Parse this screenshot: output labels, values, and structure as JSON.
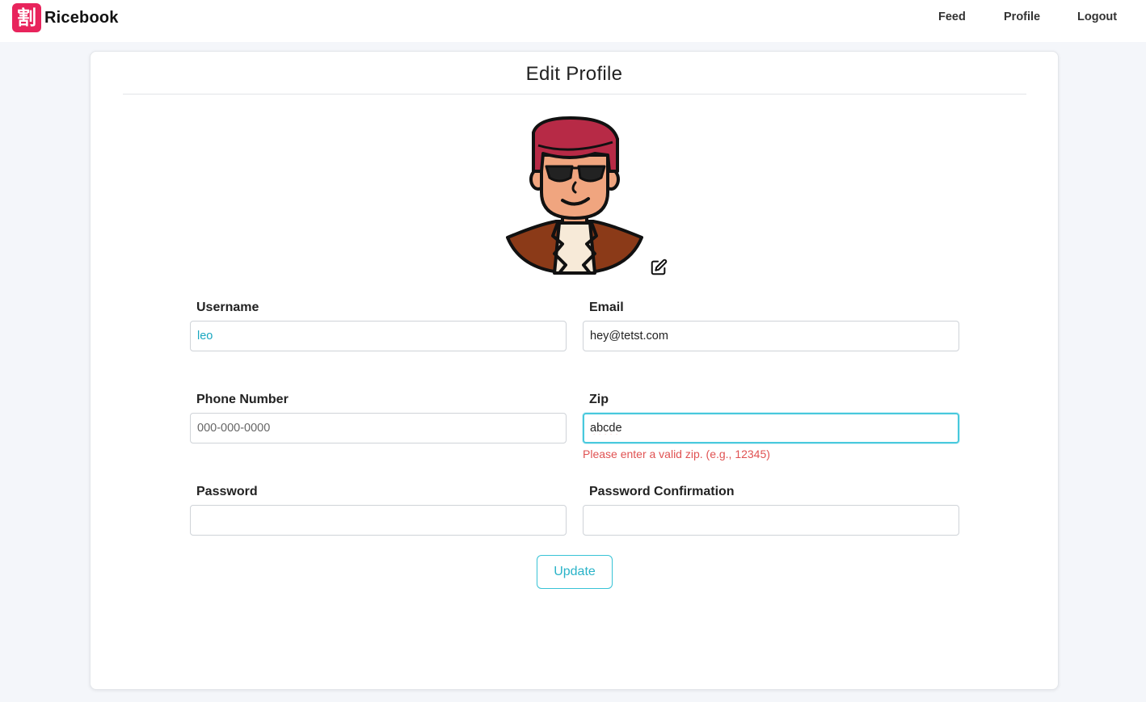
{
  "navbar": {
    "brand": {
      "logo_glyph": "割",
      "name": "Ricebook",
      "logo_color": "#e8245c"
    },
    "links": [
      {
        "label": "Feed"
      },
      {
        "label": "Profile"
      },
      {
        "label": "Logout"
      }
    ]
  },
  "card": {
    "title": "Edit Profile",
    "avatar": {
      "icon": "cartoon-man-avatar",
      "edit_icon": "edit-pencil-square-icon"
    },
    "fields": {
      "username": {
        "label": "Username",
        "value": "leo",
        "placeholder": ""
      },
      "email": {
        "label": "Email",
        "value": "hey@tetst.com",
        "placeholder": ""
      },
      "phone": {
        "label": "Phone Number",
        "value": "",
        "placeholder": "000-000-0000"
      },
      "zip": {
        "label": "Zip",
        "value": "abcde",
        "placeholder": "",
        "error": "Please enter a valid zip. (e.g., 12345)"
      },
      "password": {
        "label": "Password",
        "value": "",
        "placeholder": ""
      },
      "password_confirmation": {
        "label": "Password Confirmation",
        "value": "",
        "placeholder": ""
      }
    },
    "update_button": {
      "label": "Update"
    }
  },
  "colors": {
    "accent": "#2ab3c8",
    "focus_border": "#48c9dd",
    "error": "#e05252",
    "background": "#f4f6fa"
  }
}
